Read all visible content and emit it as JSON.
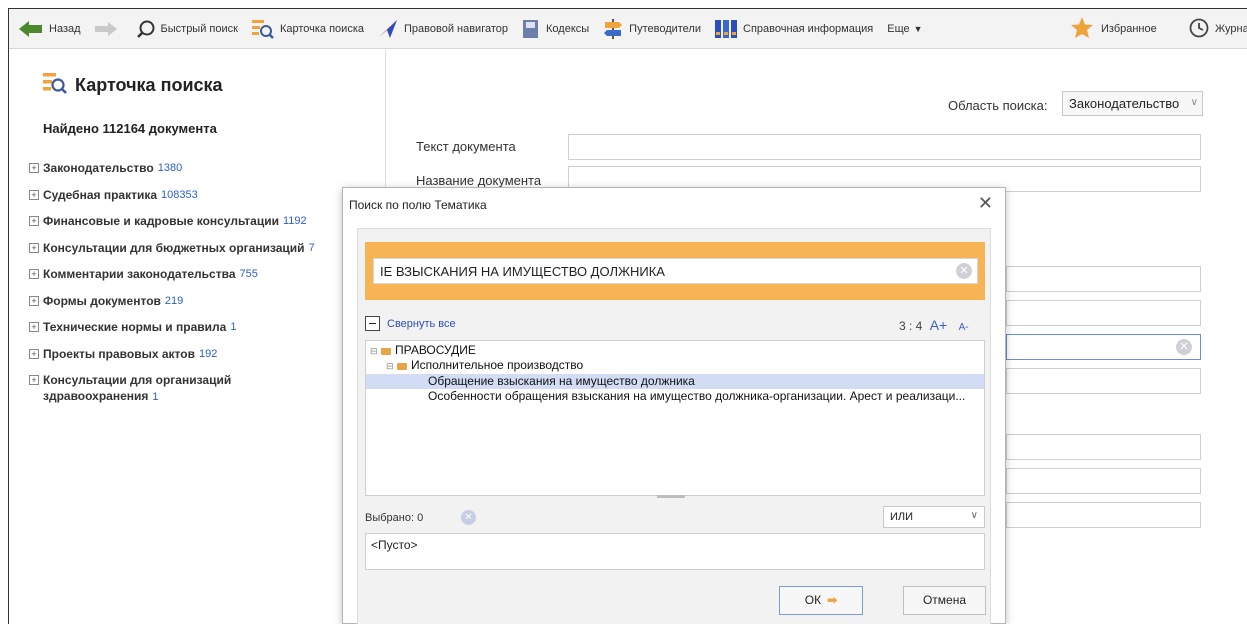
{
  "toolbar": {
    "back": "Назад",
    "quick_search": "Быстрый поиск",
    "search_card": "Карточка поиска",
    "legal_navigator": "Правовой навигатор",
    "codes": "Кодексы",
    "guides": "Путеводители",
    "reference": "Справочная информация",
    "more": "Еще",
    "favorites": "Избранное",
    "journal": "Журна"
  },
  "left": {
    "title": "Карточка поиска",
    "found": "Найдено 112164 документа",
    "categories": [
      {
        "label": "Законодательство",
        "count": "1380"
      },
      {
        "label": "Судебная практика",
        "count": "108353"
      },
      {
        "label": "Финансовые и кадровые консультации",
        "count": "1192"
      },
      {
        "label": "Консультации для бюджетных организаций",
        "count": "7"
      },
      {
        "label": "Комментарии законодательства",
        "count": "755"
      },
      {
        "label": "Формы документов",
        "count": "219"
      },
      {
        "label": "Технические нормы и правила",
        "count": "1"
      },
      {
        "label": "Проекты правовых актов",
        "count": "192"
      },
      {
        "label": "Консультации для организаций здравоохранения",
        "count": "1"
      }
    ]
  },
  "right": {
    "area_label": "Область поиска:",
    "area_value": "Законодательство",
    "field_text": "Текст документа",
    "field_name": "Название документа"
  },
  "dialog": {
    "title": "Поиск по полю Тематика",
    "search_value": "IE ВЗЫСКАНИЯ НА ИМУЩЕСТВО ДОЛЖНИКА",
    "collapse_all": "Свернуть все",
    "zoom_ratio": "3 : 4",
    "zoom_in": "A+",
    "zoom_out": "A-",
    "tree": [
      {
        "label": "ПРАВОСУДИЕ",
        "level": 0
      },
      {
        "label": "Исполнительное производство",
        "level": 1
      },
      {
        "label": "Обращение взыскания на имущество должника",
        "level": 2
      },
      {
        "label": "Особенности обращения взыскания на имущество должника-организации. Арест и реализаци...",
        "level": 2
      }
    ],
    "selected_label": "Выбрано: 0",
    "logic_value": "ИЛИ",
    "empty_text": "<Пусто>",
    "ok": "ОК",
    "cancel": "Отмена"
  },
  "colors": {
    "accent_orange": "#f7b455",
    "link_blue": "#2b5fc8",
    "selection": "#d2dcf4"
  }
}
